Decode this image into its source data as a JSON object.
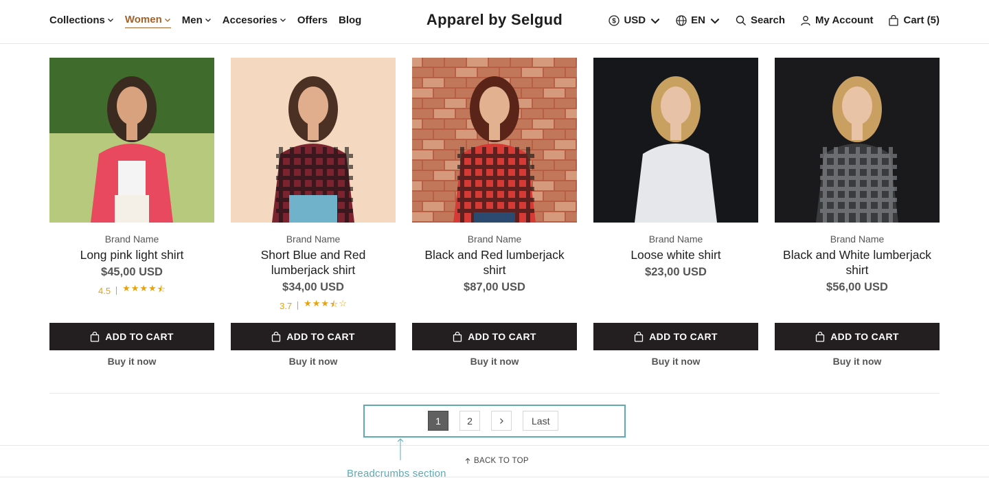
{
  "header": {
    "nav": [
      {
        "label": "Collections",
        "dropdown": true,
        "active": false
      },
      {
        "label": "Women",
        "dropdown": true,
        "active": true
      },
      {
        "label": "Men",
        "dropdown": true,
        "active": false
      },
      {
        "label": "Accesories",
        "dropdown": true,
        "active": false
      },
      {
        "label": "Offers",
        "dropdown": false,
        "active": false
      },
      {
        "label": "Blog",
        "dropdown": false,
        "active": false
      }
    ],
    "title": "Apparel by Selgud",
    "currency": "USD",
    "language": "EN",
    "search_label": "Search",
    "account_label": "My Account",
    "cart_label": "Cart (5)"
  },
  "products": [
    {
      "brand": "Brand Name",
      "name": "Long pink light shirt",
      "price": "$45,00 USD",
      "rating": "4.5",
      "stars": 4.5,
      "add_label": "ADD TO CART",
      "buy_label": "Buy it now",
      "palette": {
        "bg": "#5d8a3c",
        "bg2": "#b7c97d",
        "shirt": "#e8495f",
        "skin": "#d9a27f",
        "hair": "#3a2a20"
      }
    },
    {
      "brand": "Brand Name",
      "name": "Short Blue and Red lumberjack shirt",
      "price": "$34,00 USD",
      "rating": "3.7",
      "stars": 3.5,
      "add_label": "ADD TO CART",
      "buy_label": "Buy it now",
      "palette": {
        "bg": "#f6dcc5",
        "bg2": "#f3d2b6",
        "shirt": "#7b2430",
        "skin": "#e0ae8c",
        "hair": "#4a3123"
      }
    },
    {
      "brand": "Brand Name",
      "name": "Black and Red lumberjack shirt",
      "price": "$87,00 USD",
      "rating": null,
      "stars": 0,
      "add_label": "ADD TO CART",
      "buy_label": "Buy it now",
      "palette": {
        "bg": "#b75e45",
        "bg2": "#d49a7b",
        "shirt": "#d63a35",
        "skin": "#e2b190",
        "hair": "#5a2418"
      }
    },
    {
      "brand": "Brand Name",
      "name": "Loose white shirt",
      "price": "$23,00 USD",
      "rating": null,
      "stars": 0,
      "add_label": "ADD TO CART",
      "buy_label": "Buy it now",
      "palette": {
        "bg": "#121315",
        "bg2": "#1d1f22",
        "shirt": "#e6e7ea",
        "skin": "#e7c2a6",
        "hair": "#c8a060"
      }
    },
    {
      "brand": "Brand Name",
      "name": "Black and White lumberjack shirt",
      "price": "$56,00 USD",
      "rating": null,
      "stars": 0,
      "add_label": "ADD TO CART",
      "buy_label": "Buy it now",
      "palette": {
        "bg": "#161719",
        "bg2": "#202124",
        "shirt": "#3a3b3d",
        "skin": "#e9c3a5",
        "hair": "#c9a062"
      }
    }
  ],
  "pagination": {
    "pages": [
      "1",
      "2"
    ],
    "active": "1",
    "last_label": "Last"
  },
  "back_to_top": "BACK TO TOP",
  "annotation": "Breadcrumbs section",
  "colors": {
    "accent": "#a3622b",
    "button": "#231f20",
    "star": "#e8a20c",
    "annotation": "#5fa9b3"
  }
}
